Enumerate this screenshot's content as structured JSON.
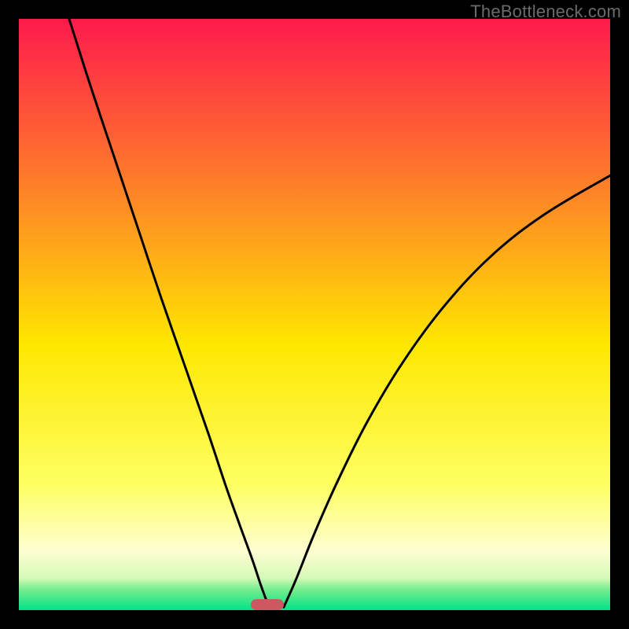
{
  "watermark": "TheBottleneck.com",
  "colors": {
    "top": "#fe1a4c",
    "upper_mid": "#fe9421",
    "mid": "#fee700",
    "lower_mid": "#fefed2",
    "green_start": "#a9f381",
    "green_end": "#00e387",
    "curve": "#000000",
    "marker": "#cd5960",
    "frame": "#000000"
  },
  "chart_data": {
    "type": "line",
    "title": "",
    "xlabel": "",
    "ylabel": "",
    "xlim": [
      0,
      100
    ],
    "ylim": [
      0,
      100
    ],
    "notes": "Two descending curves meeting near x≈42 at y≈0; gradient background red→green top→bottom; small marker at bottom.",
    "background_gradient_stops": [
      {
        "offset": 0.0,
        "color": "#fe1a4c"
      },
      {
        "offset": 0.29,
        "color": "#fe8228"
      },
      {
        "offset": 0.55,
        "color": "#fee700"
      },
      {
        "offset": 0.79,
        "color": "#feff63"
      },
      {
        "offset": 0.9,
        "color": "#fefed2"
      },
      {
        "offset": 0.945,
        "color": "#d7fab8"
      },
      {
        "offset": 0.965,
        "color": "#76ed8f"
      },
      {
        "offset": 1.0,
        "color": "#00e387"
      }
    ],
    "series": [
      {
        "name": "left-curve",
        "x": [
          8.5,
          12,
          16,
          20,
          24,
          28,
          32,
          35,
          37.5,
          39.5,
          41,
          42.3
        ],
        "y": [
          100,
          89,
          77,
          65,
          53,
          41.5,
          30,
          21,
          14,
          8.5,
          4,
          0.5
        ]
      },
      {
        "name": "right-curve",
        "x": [
          44.8,
          47,
          50,
          54,
          59,
          65,
          72,
          80,
          89,
          100
        ],
        "y": [
          0.5,
          5.5,
          13,
          22,
          32,
          42,
          51.5,
          60,
          67,
          73.5
        ]
      }
    ],
    "marker": {
      "x_center": 42,
      "width_pct": 5.5,
      "y": 0,
      "color": "#cd5960"
    }
  }
}
